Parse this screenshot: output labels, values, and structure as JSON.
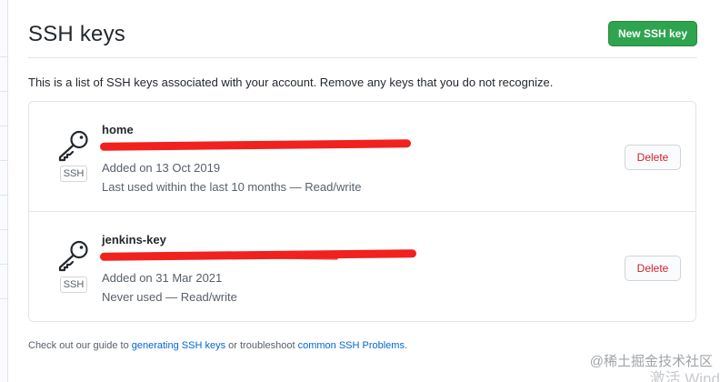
{
  "header": {
    "title": "SSH keys",
    "new_button_label": "New SSH key"
  },
  "intro_text": "This is a list of SSH keys associated with your account. Remove any keys that you do not recognize.",
  "keys": [
    {
      "name": "home",
      "badge": "SSH",
      "fingerprint": "",
      "added": "Added on 13 Oct 2019",
      "last_used": "Last used within the last 10 months — Read/write",
      "delete_label": "Delete"
    },
    {
      "name": "jenkins-key",
      "badge": "SSH",
      "fingerprint": "",
      "added": "Added on 31 Mar 2021",
      "last_used": "Never used — Read/write",
      "delete_label": "Delete"
    }
  ],
  "footer": {
    "prefix": "Check out our guide to ",
    "link1": "generating SSH keys",
    "middle": " or troubleshoot ",
    "link2": "common SSH Problems",
    "suffix": "."
  },
  "watermark": {
    "line1": "@稀土掘金技术社区",
    "line2": "激活 Wind"
  },
  "colors": {
    "primary_button": "#2ea44f",
    "danger_text": "#cb2431",
    "link": "#0366d6",
    "redaction": "#f0211e"
  },
  "icons": {
    "key": "key-icon"
  }
}
